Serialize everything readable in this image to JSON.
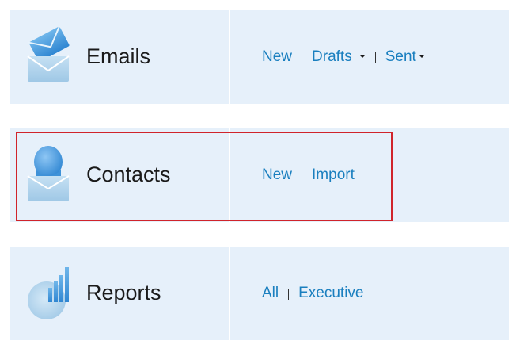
{
  "emails": {
    "title": "Emails",
    "icon": "envelope-icon",
    "links": {
      "new": "New",
      "drafts": "Drafts",
      "sent": "Sent"
    }
  },
  "contacts": {
    "title": "Contacts",
    "icon": "contact-person-icon",
    "links": {
      "new": "New",
      "import": "Import"
    }
  },
  "reports": {
    "title": "Reports",
    "icon": "bar-pie-chart-icon",
    "links": {
      "all": "All",
      "executive": "Executive"
    }
  },
  "colors": {
    "card_background": "#e6f0fa",
    "link": "#1a7fbf",
    "highlight_border": "#d0242b"
  }
}
